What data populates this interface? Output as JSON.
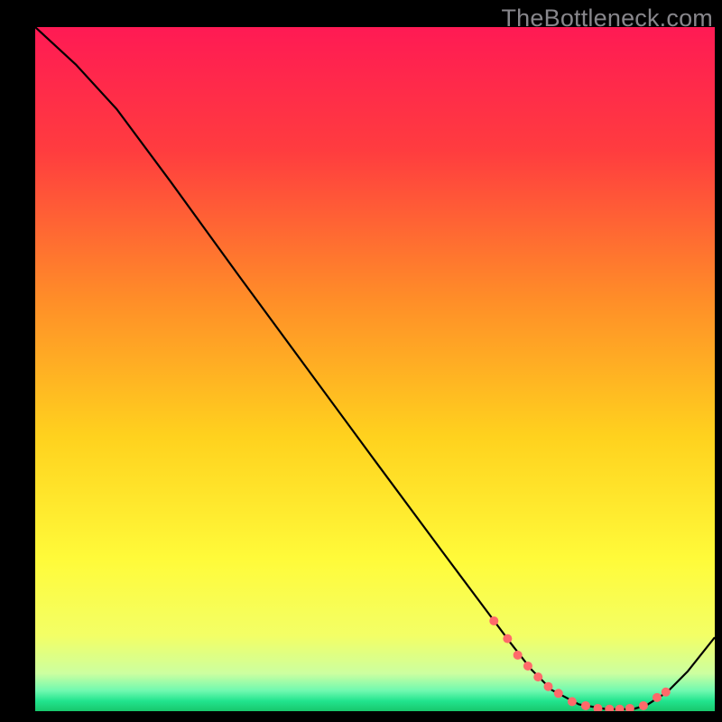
{
  "watermark": "TheBottleneck.com",
  "chart_data": {
    "type": "line",
    "title": "",
    "xlabel": "",
    "ylabel": "",
    "xlim": [
      0,
      100
    ],
    "ylim": [
      0,
      100
    ],
    "background_gradient": {
      "stops": [
        {
          "offset": 0.0,
          "color": "#ff1a54"
        },
        {
          "offset": 0.18,
          "color": "#ff3c3f"
        },
        {
          "offset": 0.4,
          "color": "#ff8e28"
        },
        {
          "offset": 0.6,
          "color": "#ffd21e"
        },
        {
          "offset": 0.78,
          "color": "#fffb3a"
        },
        {
          "offset": 0.89,
          "color": "#f3ff66"
        },
        {
          "offset": 0.945,
          "color": "#ccffa0"
        },
        {
          "offset": 0.97,
          "color": "#70f9b0"
        },
        {
          "offset": 0.985,
          "color": "#22e48e"
        },
        {
          "offset": 1.0,
          "color": "#18c76c"
        }
      ]
    },
    "series": [
      {
        "name": "curve",
        "color": "#000000",
        "x": [
          0,
          6,
          12,
          20,
          30,
          40,
          50,
          60,
          67,
          70,
          73,
          76,
          80,
          84,
          88,
          90,
          93,
          96,
          100
        ],
        "y": [
          100,
          94.5,
          88,
          77.3,
          63.6,
          50.1,
          36.6,
          23.2,
          13.9,
          9.9,
          6.1,
          3.1,
          1.0,
          0.3,
          0.3,
          0.9,
          2.8,
          5.8,
          10.8
        ]
      }
    ],
    "markers": {
      "name": "dots",
      "color": "#ff6a6a",
      "radius": 5,
      "x": [
        67.5,
        69.5,
        71,
        72.5,
        74,
        75.5,
        77,
        79,
        81,
        82.8,
        84.5,
        86,
        87.5,
        89.5,
        91.5,
        92.8
      ],
      "y": [
        13.2,
        10.6,
        8.2,
        6.6,
        5.0,
        3.6,
        2.6,
        1.4,
        0.8,
        0.4,
        0.3,
        0.3,
        0.4,
        0.8,
        2.0,
        2.8
      ]
    }
  }
}
